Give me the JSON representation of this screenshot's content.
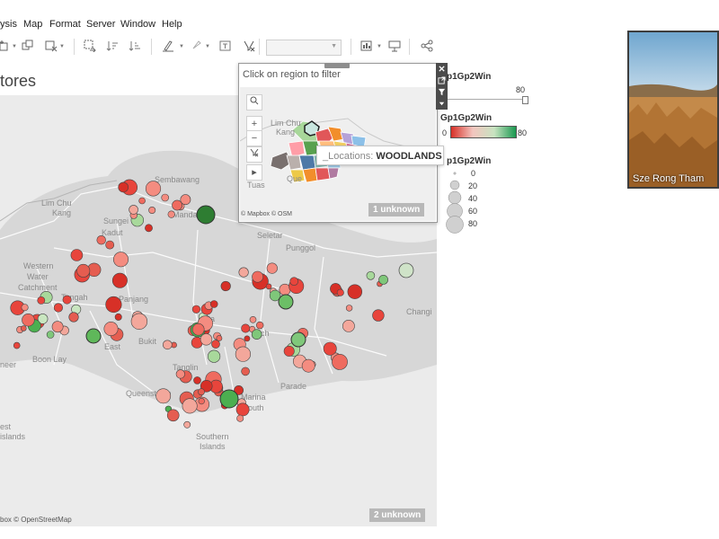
{
  "menu": [
    "ysis",
    "Map",
    "Format",
    "Server",
    "Window",
    "Help"
  ],
  "title": "tores",
  "popup": {
    "header": "Click on region to filter",
    "attribution": "© Mapbox © OSM",
    "unknown": "1 unknown",
    "map_labels": [
      "Lim Chu",
      "Kang",
      "Tuas",
      "Que"
    ]
  },
  "tooltip": {
    "key": "_Locations:",
    "value": "WOODLANDS"
  },
  "main_map": {
    "attribution": "box © OpenStreetMap",
    "unknown": "2 unknown",
    "labels": [
      "Sembawang",
      "Lim Chu",
      "Kang",
      "Sungei",
      "Kadut",
      "Mandai",
      "Seletar",
      "Punggol",
      "Western",
      "Water",
      "Catchment",
      "Tengah",
      "Panjang",
      "Bukit",
      "East",
      "Boon Lay",
      "Queenstown",
      "Tanglin",
      "Marina",
      "South",
      "Southern",
      "Islands",
      "Changi",
      "neer",
      "est",
      "islands",
      "Pa",
      "uch",
      "Parade"
    ]
  },
  "legend": {
    "color_title": "Gp1Gp2Win",
    "color_min": "0",
    "color_max": "80",
    "filter_title": "p1Gp2Win",
    "filter_value": "80",
    "size_title": "p1Gp2Win",
    "size_values": [
      "0",
      "20",
      "40",
      "60",
      "80"
    ],
    "colors": {
      "low": "#d73027",
      "mid": "#f7e3e0",
      "high": "#1a9850"
    }
  },
  "video": {
    "name": "Sze Rong Tham"
  }
}
